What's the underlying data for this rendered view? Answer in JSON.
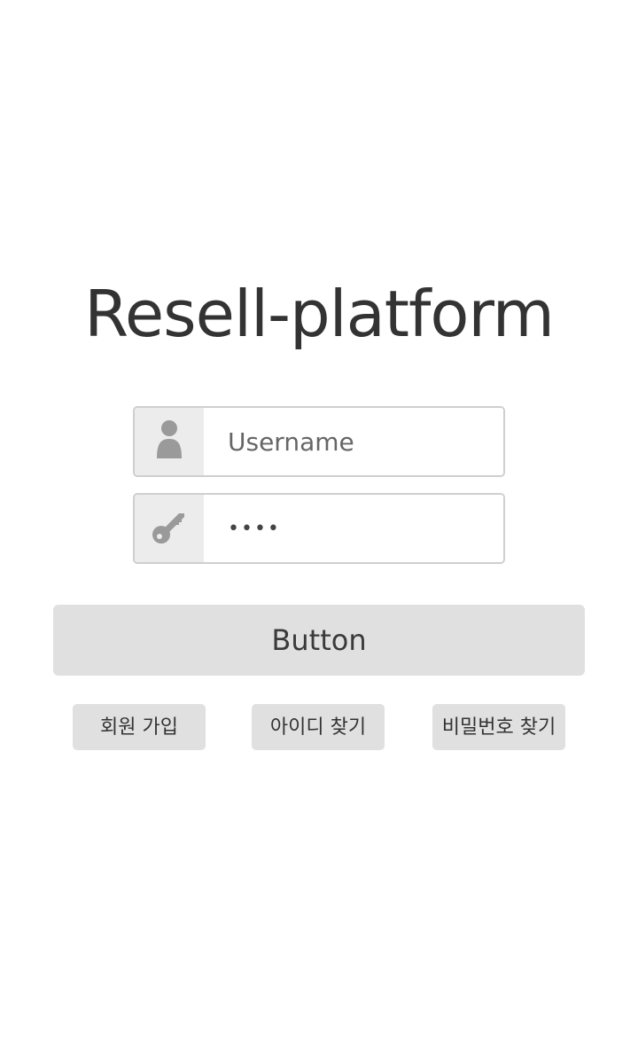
{
  "app": {
    "title": "Resell-platform"
  },
  "login_form": {
    "username": {
      "icon": "user-icon",
      "placeholder": "Username",
      "value": ""
    },
    "password": {
      "icon": "key-icon",
      "value": "••••"
    },
    "submit_label": "Button"
  },
  "links": {
    "signup_label": "회원 가입",
    "find_id_label": "아이디 찾기",
    "find_password_label": "비밀번호 찾기"
  },
  "colors": {
    "text": "#333333",
    "button_bg": "#e0e0e0",
    "addon_bg": "#ececec",
    "border": "#cfcfcf",
    "icon": "#9a9a9a"
  }
}
